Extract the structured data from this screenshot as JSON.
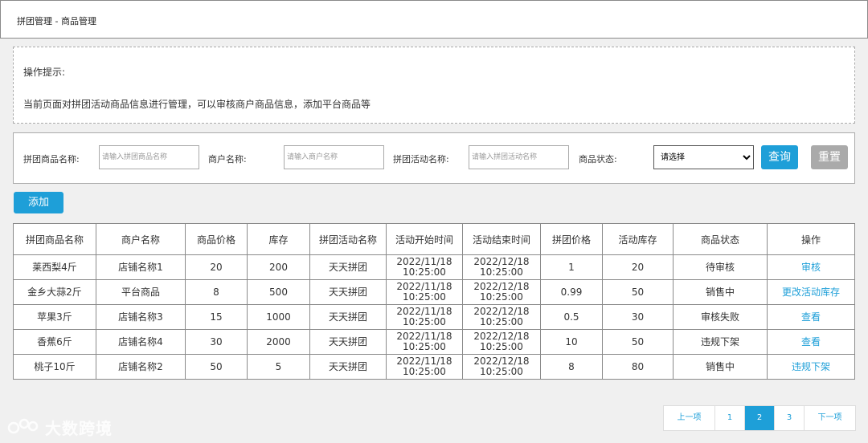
{
  "breadcrumb": "拼团管理 - 商品管理",
  "tips": {
    "title": "操作提示:",
    "text": "当前页面对拼团活动商品信息进行管理，可以审核商户商品信息，添加平台商品等"
  },
  "search": {
    "fields": [
      {
        "label": "拼团商品名称:",
        "placeholder": "请输入拼团商品名称"
      },
      {
        "label": "商户名称:",
        "placeholder": "请输入商户名称"
      },
      {
        "label": "拼团活动名称:",
        "placeholder": "请输入拼团活动名称"
      }
    ],
    "status_label": "商品状态:",
    "status_value": "请选择",
    "query_label": "查询",
    "reset_label": "重置"
  },
  "add_label": "添加",
  "table": {
    "headers": [
      "拼团商品名称",
      "商户名称",
      "商品价格",
      "库存",
      "拼团活动名称",
      "活动开始时间",
      "活动结束时间",
      "拼团价格",
      "活动库存",
      "商品状态",
      "操作"
    ],
    "rows": [
      {
        "name": "莱西梨4斤",
        "merchant": "店铺名称1",
        "price": "20",
        "stock": "200",
        "activity": "天天拼团",
        "start": "2022/11/18 10:25:00",
        "end": "2022/12/18 10:25:00",
        "group_price": "1",
        "activity_stock": "20",
        "status": "待审核",
        "action": "审核"
      },
      {
        "name": "金乡大蒜2斤",
        "merchant": "平台商品",
        "price": "8",
        "stock": "500",
        "activity": "天天拼团",
        "start": "2022/11/18 10:25:00",
        "end": "2022/12/18 10:25:00",
        "group_price": "0.99",
        "activity_stock": "50",
        "status": "销售中",
        "action": "更改活动库存"
      },
      {
        "name": "苹果3斤",
        "merchant": "店铺名称3",
        "price": "15",
        "stock": "1000",
        "activity": "天天拼团",
        "start": "2022/11/18 10:25:00",
        "end": "2022/12/18 10:25:00",
        "group_price": "0.5",
        "activity_stock": "30",
        "status": "审核失败",
        "action": "查看"
      },
      {
        "name": "香蕉6斤",
        "merchant": "店铺名称4",
        "price": "30",
        "stock": "2000",
        "activity": "天天拼团",
        "start": "2022/11/18 10:25:00",
        "end": "2022/12/18 10:25:00",
        "group_price": "10",
        "activity_stock": "50",
        "status": "违规下架",
        "action": "查看"
      },
      {
        "name": "桃子10斤",
        "merchant": "店铺名称2",
        "price": "50",
        "stock": "5",
        "activity": "天天拼团",
        "start": "2022/11/18 10:25:00",
        "end": "2022/12/18 10:25:00",
        "group_price": "8",
        "activity_stock": "80",
        "status": "销售中",
        "action": "违规下架"
      }
    ]
  },
  "pagination": {
    "prev": "上一项",
    "pages": [
      "1",
      "2",
      "3"
    ],
    "current": "2",
    "next": "下一项"
  },
  "watermark": "大数跨境",
  "colors": {
    "accent": "#1e9fd8",
    "reset": "#aaaaaa"
  }
}
